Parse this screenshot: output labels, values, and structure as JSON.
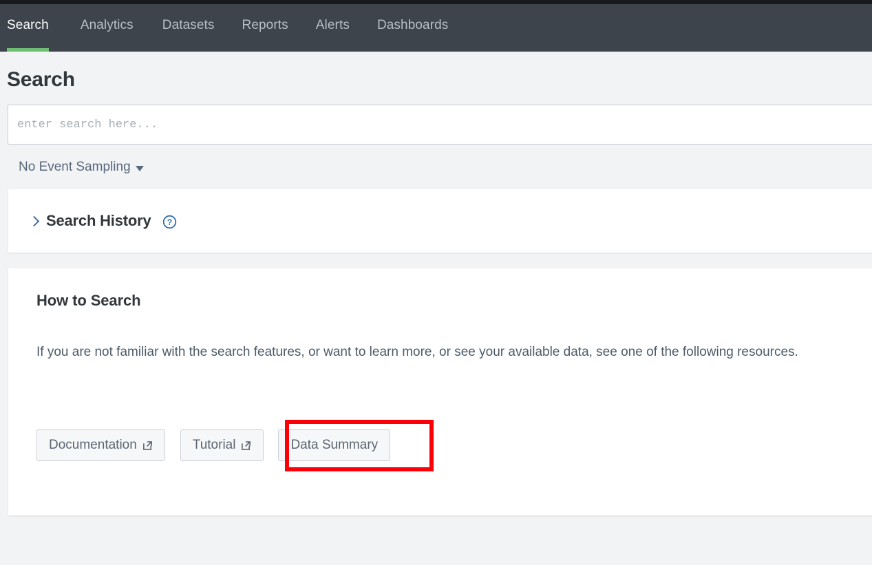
{
  "topnav": {
    "items": [
      {
        "label": "Search",
        "active": true
      },
      {
        "label": "Analytics",
        "active": false
      },
      {
        "label": "Datasets",
        "active": false
      },
      {
        "label": "Reports",
        "active": false
      },
      {
        "label": "Alerts",
        "active": false
      },
      {
        "label": "Dashboards",
        "active": false
      }
    ],
    "active_indicator_color": "#6fbf73",
    "background_color": "#3e444c"
  },
  "page": {
    "title": "Search"
  },
  "search": {
    "value": "",
    "placeholder": "enter search here..."
  },
  "sampling": {
    "label": "No Event Sampling",
    "caret": "caret-down-icon"
  },
  "search_history": {
    "label": "Search History",
    "chevron": "chevron-right-icon",
    "help": "help-circle-icon",
    "help_color": "#2f6fad",
    "expanded": false
  },
  "how_to_search": {
    "title": "How to Search",
    "body": "If you are not familiar with the search features, or want to learn more, or see your available data, see one of the following resources.",
    "buttons": [
      {
        "label": "Documentation",
        "icon": "external-link-icon",
        "highlighted": false
      },
      {
        "label": "Tutorial",
        "icon": "external-link-icon",
        "highlighted": false
      },
      {
        "label": "Data Summary",
        "icon": null,
        "highlighted": true
      }
    ]
  },
  "annotation": {
    "type": "highlight-box",
    "target": "Data Summary",
    "color": "#fb0007"
  }
}
